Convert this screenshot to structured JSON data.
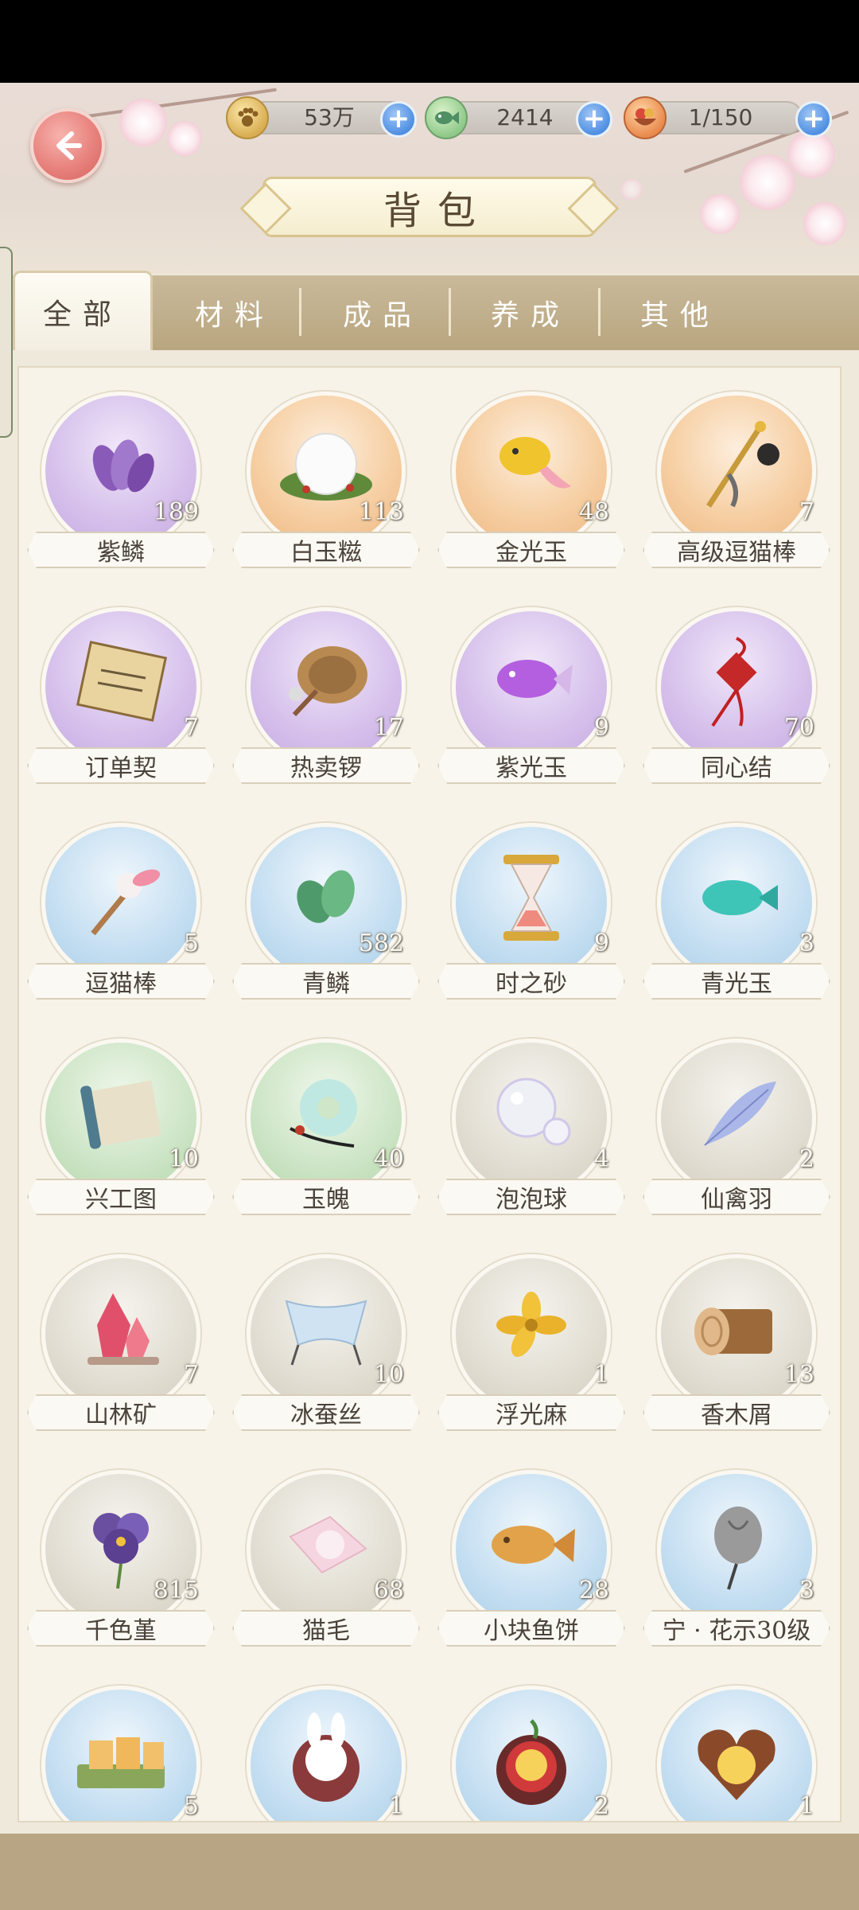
{
  "header": {
    "title": "背包",
    "currencies": [
      {
        "icon": "paw-coin-icon",
        "value": "53万"
      },
      {
        "icon": "fish-token-icon",
        "value": "2414"
      },
      {
        "icon": "food-bowl-icon",
        "value": "1/150"
      }
    ]
  },
  "tabs": [
    {
      "label": "全部",
      "active": true
    },
    {
      "label": "材料",
      "active": false
    },
    {
      "label": "成品",
      "active": false
    },
    {
      "label": "养成",
      "active": false
    },
    {
      "label": "其他",
      "active": false
    }
  ],
  "items": [
    {
      "name": "紫鳞",
      "count": "189",
      "rarity": "purple",
      "icon": "purple-scales-icon"
    },
    {
      "name": "白玉糍",
      "count": "113",
      "rarity": "orange",
      "icon": "white-mochi-icon"
    },
    {
      "name": "金光玉",
      "count": "48",
      "rarity": "orange",
      "icon": "golden-fish-jade-icon"
    },
    {
      "name": "高级逗猫棒",
      "count": "7",
      "rarity": "orange",
      "icon": "premium-cat-teaser-icon"
    },
    {
      "name": "订单契",
      "count": "7",
      "rarity": "purple",
      "icon": "order-contract-icon"
    },
    {
      "name": "热卖锣",
      "count": "17",
      "rarity": "purple",
      "icon": "gong-icon"
    },
    {
      "name": "紫光玉",
      "count": "9",
      "rarity": "purple",
      "icon": "purple-fish-jade-icon"
    },
    {
      "name": "同心结",
      "count": "70",
      "rarity": "purple",
      "icon": "chinese-knot-icon"
    },
    {
      "name": "逗猫棒",
      "count": "5",
      "rarity": "blue",
      "icon": "cat-teaser-icon"
    },
    {
      "name": "青鳞",
      "count": "582",
      "rarity": "blue",
      "icon": "green-scales-icon"
    },
    {
      "name": "时之砂",
      "count": "9",
      "rarity": "blue",
      "icon": "hourglass-icon"
    },
    {
      "name": "青光玉",
      "count": "3",
      "rarity": "blue",
      "icon": "cyan-fish-jade-icon"
    },
    {
      "name": "兴工图",
      "count": "10",
      "rarity": "green",
      "icon": "scroll-icon"
    },
    {
      "name": "玉魄",
      "count": "40",
      "rarity": "green",
      "icon": "jade-ring-icon"
    },
    {
      "name": "泡泡球",
      "count": "4",
      "rarity": "gray",
      "icon": "bubble-icon"
    },
    {
      "name": "仙禽羽",
      "count": "2",
      "rarity": "gray",
      "icon": "feather-icon"
    },
    {
      "name": "山林矿",
      "count": "7",
      "rarity": "gray",
      "icon": "crystal-ore-icon"
    },
    {
      "name": "冰蚕丝",
      "count": "10",
      "rarity": "gray",
      "icon": "silk-cloth-icon"
    },
    {
      "name": "浮光麻",
      "count": "1",
      "rarity": "gray",
      "icon": "yellow-flower-icon"
    },
    {
      "name": "香木屑",
      "count": "13",
      "rarity": "gray",
      "icon": "wood-log-icon"
    },
    {
      "name": "千色堇",
      "count": "815",
      "rarity": "gray",
      "icon": "pansy-icon"
    },
    {
      "name": "猫毛",
      "count": "68",
      "rarity": "gray",
      "icon": "cat-fur-icon"
    },
    {
      "name": "小块鱼饼",
      "count": "28",
      "rarity": "blue",
      "icon": "fish-cake-icon"
    },
    {
      "name": "宁 · 花示30级",
      "count": "3",
      "rarity": "blue",
      "icon": "silver-bud-icon"
    },
    {
      "name": "",
      "count": "5",
      "rarity": "blue",
      "icon": "cake-slices-icon"
    },
    {
      "name": "",
      "count": "1",
      "rarity": "blue",
      "icon": "bunny-cookie-icon"
    },
    {
      "name": "",
      "count": "2",
      "rarity": "blue",
      "icon": "chick-tart-icon"
    },
    {
      "name": "",
      "count": "1",
      "rarity": "blue",
      "icon": "heart-chick-cookie-icon"
    }
  ],
  "colors": {
    "purple": "#c4a9e0",
    "orange": "#eeb681",
    "blue": "#a9cde8",
    "green": "#b4d7ac",
    "gray": "#d3cdbf",
    "plus_button": "#4f8fe2",
    "back_button": "#e8827d"
  }
}
